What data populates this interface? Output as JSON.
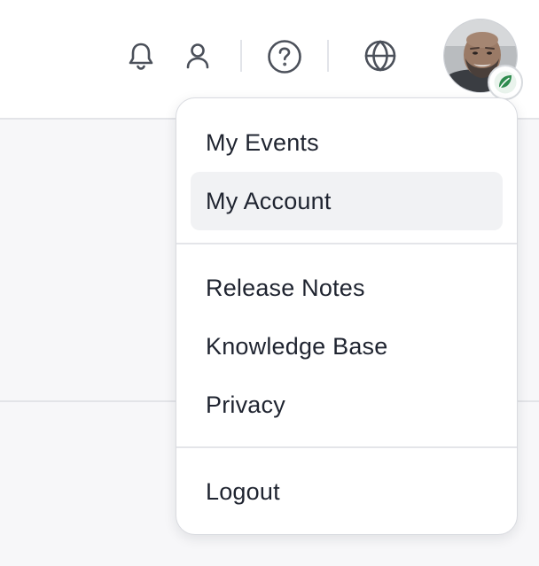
{
  "header": {
    "icons": {
      "notifications": "bell-icon",
      "user": "user-icon",
      "help": "help-circle-icon",
      "language": "globe-icon"
    },
    "avatar": {
      "badge_icon": "leaf-badge-icon",
      "badge_color": "#2e8b4e"
    }
  },
  "menu": {
    "items": [
      {
        "label": "My Events"
      },
      {
        "label": "My Account"
      },
      {
        "label": "Release Notes"
      },
      {
        "label": "Knowledge Base"
      },
      {
        "label": "Privacy"
      },
      {
        "label": "Logout"
      }
    ],
    "highlighted_item": "My Account"
  },
  "colors": {
    "icon": "#4b505a",
    "text": "#1f2430",
    "highlight": "#f1f2f4",
    "divider": "#e4e5e9"
  }
}
